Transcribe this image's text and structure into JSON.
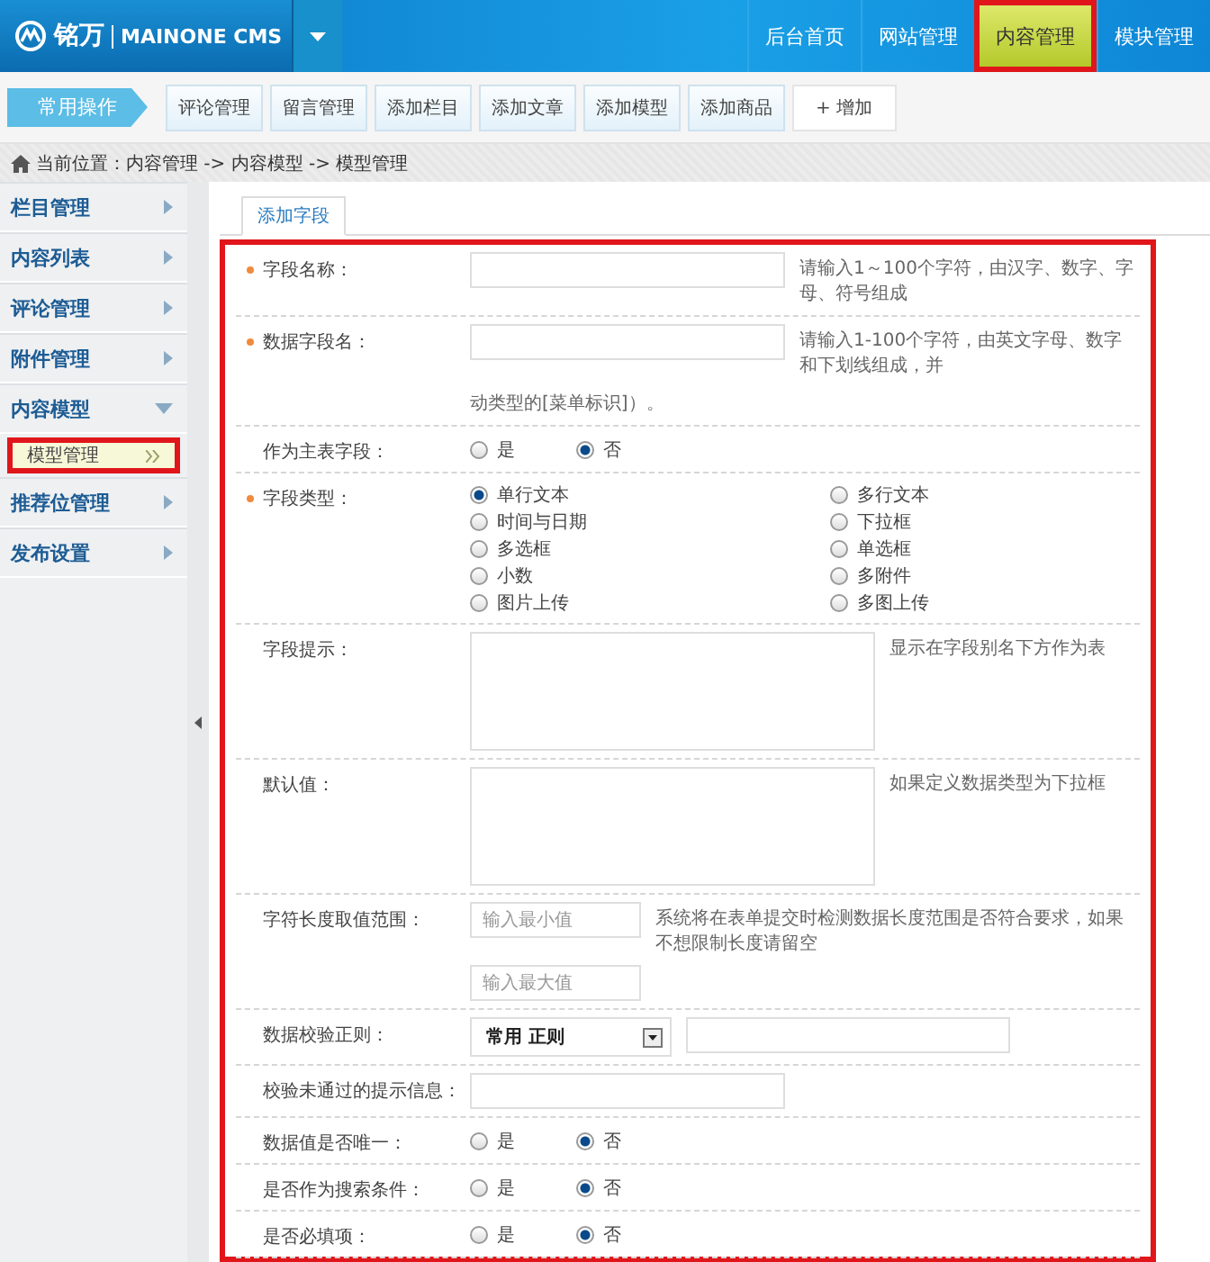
{
  "header": {
    "brand": "铭万",
    "product": "MAINONE CMS"
  },
  "top_nav": [
    {
      "label": "后台首页",
      "selected": false
    },
    {
      "label": "网站管理",
      "selected": false
    },
    {
      "label": "内容管理",
      "selected": true
    },
    {
      "label": "模块管理",
      "selected": false
    }
  ],
  "toolbar": {
    "title": "常用操作",
    "buttons": [
      "评论管理",
      "留言管理",
      "添加栏目",
      "添加文章",
      "添加模型",
      "添加商品"
    ],
    "add_button": "+ 增加"
  },
  "breadcrumb": "当前位置：内容管理 -> 内容模型 -> 模型管理",
  "sidebar": {
    "items": [
      {
        "label": "栏目管理",
        "expanded": false
      },
      {
        "label": "内容列表",
        "expanded": false
      },
      {
        "label": "评论管理",
        "expanded": false
      },
      {
        "label": "附件管理",
        "expanded": false
      },
      {
        "label": "内容模型",
        "expanded": true,
        "children": [
          {
            "label": "模型管理",
            "selected": true
          }
        ]
      },
      {
        "label": "推荐位管理",
        "expanded": false
      },
      {
        "label": "发布设置",
        "expanded": false
      }
    ]
  },
  "tabs": [
    {
      "label": "添加字段",
      "selected": true
    }
  ],
  "form": {
    "rows": [
      {
        "kind": "text",
        "required": true,
        "label": "字段名称：",
        "hint": "请输入1～100个字符，由汉字、数字、字母、符号组成"
      },
      {
        "kind": "text",
        "required": true,
        "label": "数据字段名：",
        "hint": "请输入1-100个字符，由英文字母、数字和下划线组成，并",
        "note": "动类型的[菜单标识]）。"
      },
      {
        "kind": "radio",
        "required": false,
        "label": "作为主表字段：",
        "options": [
          {
            "label": "是",
            "selected": false
          },
          {
            "label": "否",
            "selected": true
          }
        ]
      },
      {
        "kind": "radio_grid",
        "required": true,
        "label": "字段类型：",
        "options": [
          {
            "label": "单行文本",
            "selected": true
          },
          {
            "label": "多行文本",
            "selected": false
          },
          {
            "label": "时间与日期",
            "selected": false
          },
          {
            "label": "下拉框",
            "selected": false
          },
          {
            "label": "多选框",
            "selected": false
          },
          {
            "label": "单选框",
            "selected": false
          },
          {
            "label": "小数",
            "selected": false
          },
          {
            "label": "多附件",
            "selected": false
          },
          {
            "label": "图片上传",
            "selected": false
          },
          {
            "label": "多图上传",
            "selected": false
          }
        ]
      },
      {
        "kind": "textarea",
        "required": false,
        "label": "字段提示：",
        "hint": "显示在字段别名下方作为表"
      },
      {
        "kind": "textarea",
        "required": false,
        "label": "默认值：",
        "hint": "如果定义数据类型为下拉框"
      },
      {
        "kind": "range",
        "required": false,
        "label": "字符长度取值范围：",
        "min_placeholder": "输入最小值",
        "max_placeholder": "输入最大值",
        "hint": "系统将在表单提交时检测数据长度范围是否符合要求，如果不想限制长度请留空"
      },
      {
        "kind": "regex",
        "required": false,
        "label": "数据校验正则：",
        "select_value": "常用 正则"
      },
      {
        "kind": "text",
        "required": false,
        "label": "校验未通过的提示信息："
      },
      {
        "kind": "radio",
        "required": false,
        "label": "数据值是否唯一：",
        "options": [
          {
            "label": "是",
            "selected": false
          },
          {
            "label": "否",
            "selected": true
          }
        ]
      },
      {
        "kind": "radio",
        "required": false,
        "label": "是否作为搜索条件：",
        "options": [
          {
            "label": "是",
            "selected": false
          },
          {
            "label": "否",
            "selected": true
          }
        ]
      },
      {
        "kind": "radio",
        "required": false,
        "label": "是否必填项：",
        "options": [
          {
            "label": "是",
            "selected": false
          },
          {
            "label": "否",
            "selected": true
          }
        ]
      }
    ]
  }
}
